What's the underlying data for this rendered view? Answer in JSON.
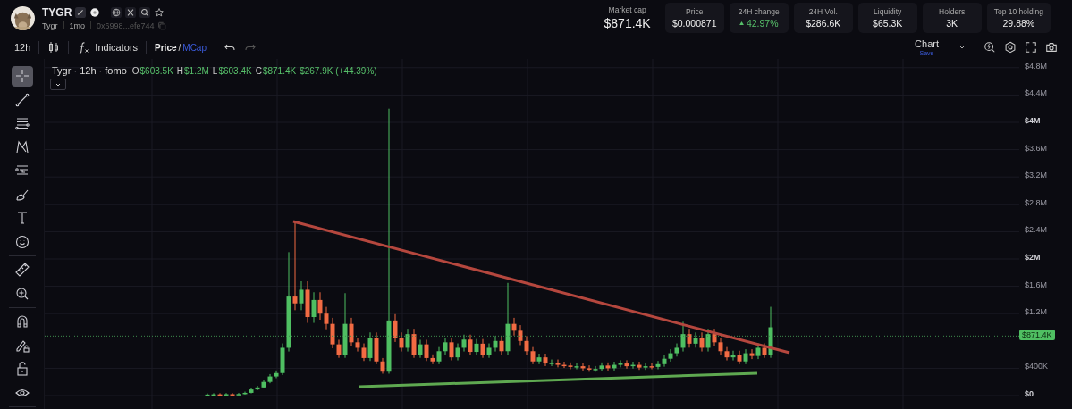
{
  "header": {
    "symbol": "TYGR",
    "name": "Tygr",
    "age": "1mo",
    "address": "0x6998...efe744"
  },
  "stats": [
    {
      "kind": "plain",
      "label": "Market cap",
      "value": "$871.4K"
    },
    {
      "kind": "card",
      "label": "Price",
      "value": "$0.000871"
    },
    {
      "kind": "change",
      "label": "24H change",
      "value": "42.97%"
    },
    {
      "kind": "card",
      "label": "24H Vol.",
      "value": "$286.6K"
    },
    {
      "kind": "card",
      "label": "Liquidity",
      "value": "$65.3K"
    },
    {
      "kind": "card",
      "label": "Holders",
      "value": "3K"
    },
    {
      "kind": "card",
      "label": "Top 10 holding",
      "value": "29.88%"
    }
  ],
  "toolbar": {
    "interval": "12h",
    "indicators": "Indicators",
    "mode_separator": "/",
    "modes": [
      {
        "label": "Price",
        "selected": false
      },
      {
        "label": "MCap",
        "selected": true
      }
    ],
    "chart_menu": {
      "label": "Chart",
      "sublabel": "Save"
    }
  },
  "legend": {
    "title": "Tygr · 12h · fomo",
    "ohlc": [
      {
        "key": "O",
        "value": "$603.5K"
      },
      {
        "key": "H",
        "value": "$1.2M"
      },
      {
        "key": "L",
        "value": "$603.4K"
      },
      {
        "key": "C",
        "value": "$871.4K"
      }
    ],
    "change": "$267.9K (+44.39%)"
  },
  "tool_groups": [
    {
      "tools": [
        {
          "kind": "crosshair",
          "selected": true
        },
        {
          "kind": "trendline",
          "selected": false
        },
        {
          "kind": "channel",
          "selected": false
        },
        {
          "kind": "pattern",
          "selected": false
        },
        {
          "kind": "position",
          "selected": false
        },
        {
          "kind": "brush",
          "selected": false
        },
        {
          "kind": "text",
          "selected": false
        },
        {
          "kind": "emoji",
          "selected": false
        }
      ]
    },
    {
      "tools": [
        {
          "kind": "ruler",
          "selected": false
        },
        {
          "kind": "zoom",
          "selected": false
        }
      ]
    },
    {
      "tools": [
        {
          "kind": "magnet",
          "selected": false
        },
        {
          "kind": "lock-draw",
          "selected": false
        },
        {
          "kind": "lock",
          "selected": false
        },
        {
          "kind": "eye",
          "selected": false
        }
      ]
    }
  ],
  "price_axis": {
    "labels": [
      {
        "text": "$4.8M",
        "major": false
      },
      {
        "text": "$4.4M",
        "major": false
      },
      {
        "text": "$4M",
        "major": true
      },
      {
        "text": "$3.6M",
        "major": false
      },
      {
        "text": "$3.2M",
        "major": false
      },
      {
        "text": "$2.8M",
        "major": false
      },
      {
        "text": "$2.4M",
        "major": false
      },
      {
        "text": "$2M",
        "major": true
      },
      {
        "text": "$1.6M",
        "major": false
      },
      {
        "text": "$1.2M",
        "major": false
      },
      {
        "text": "$400K",
        "major": false
      },
      {
        "text": "$0",
        "major": true
      }
    ],
    "last_price": "$871.4K"
  }
}
